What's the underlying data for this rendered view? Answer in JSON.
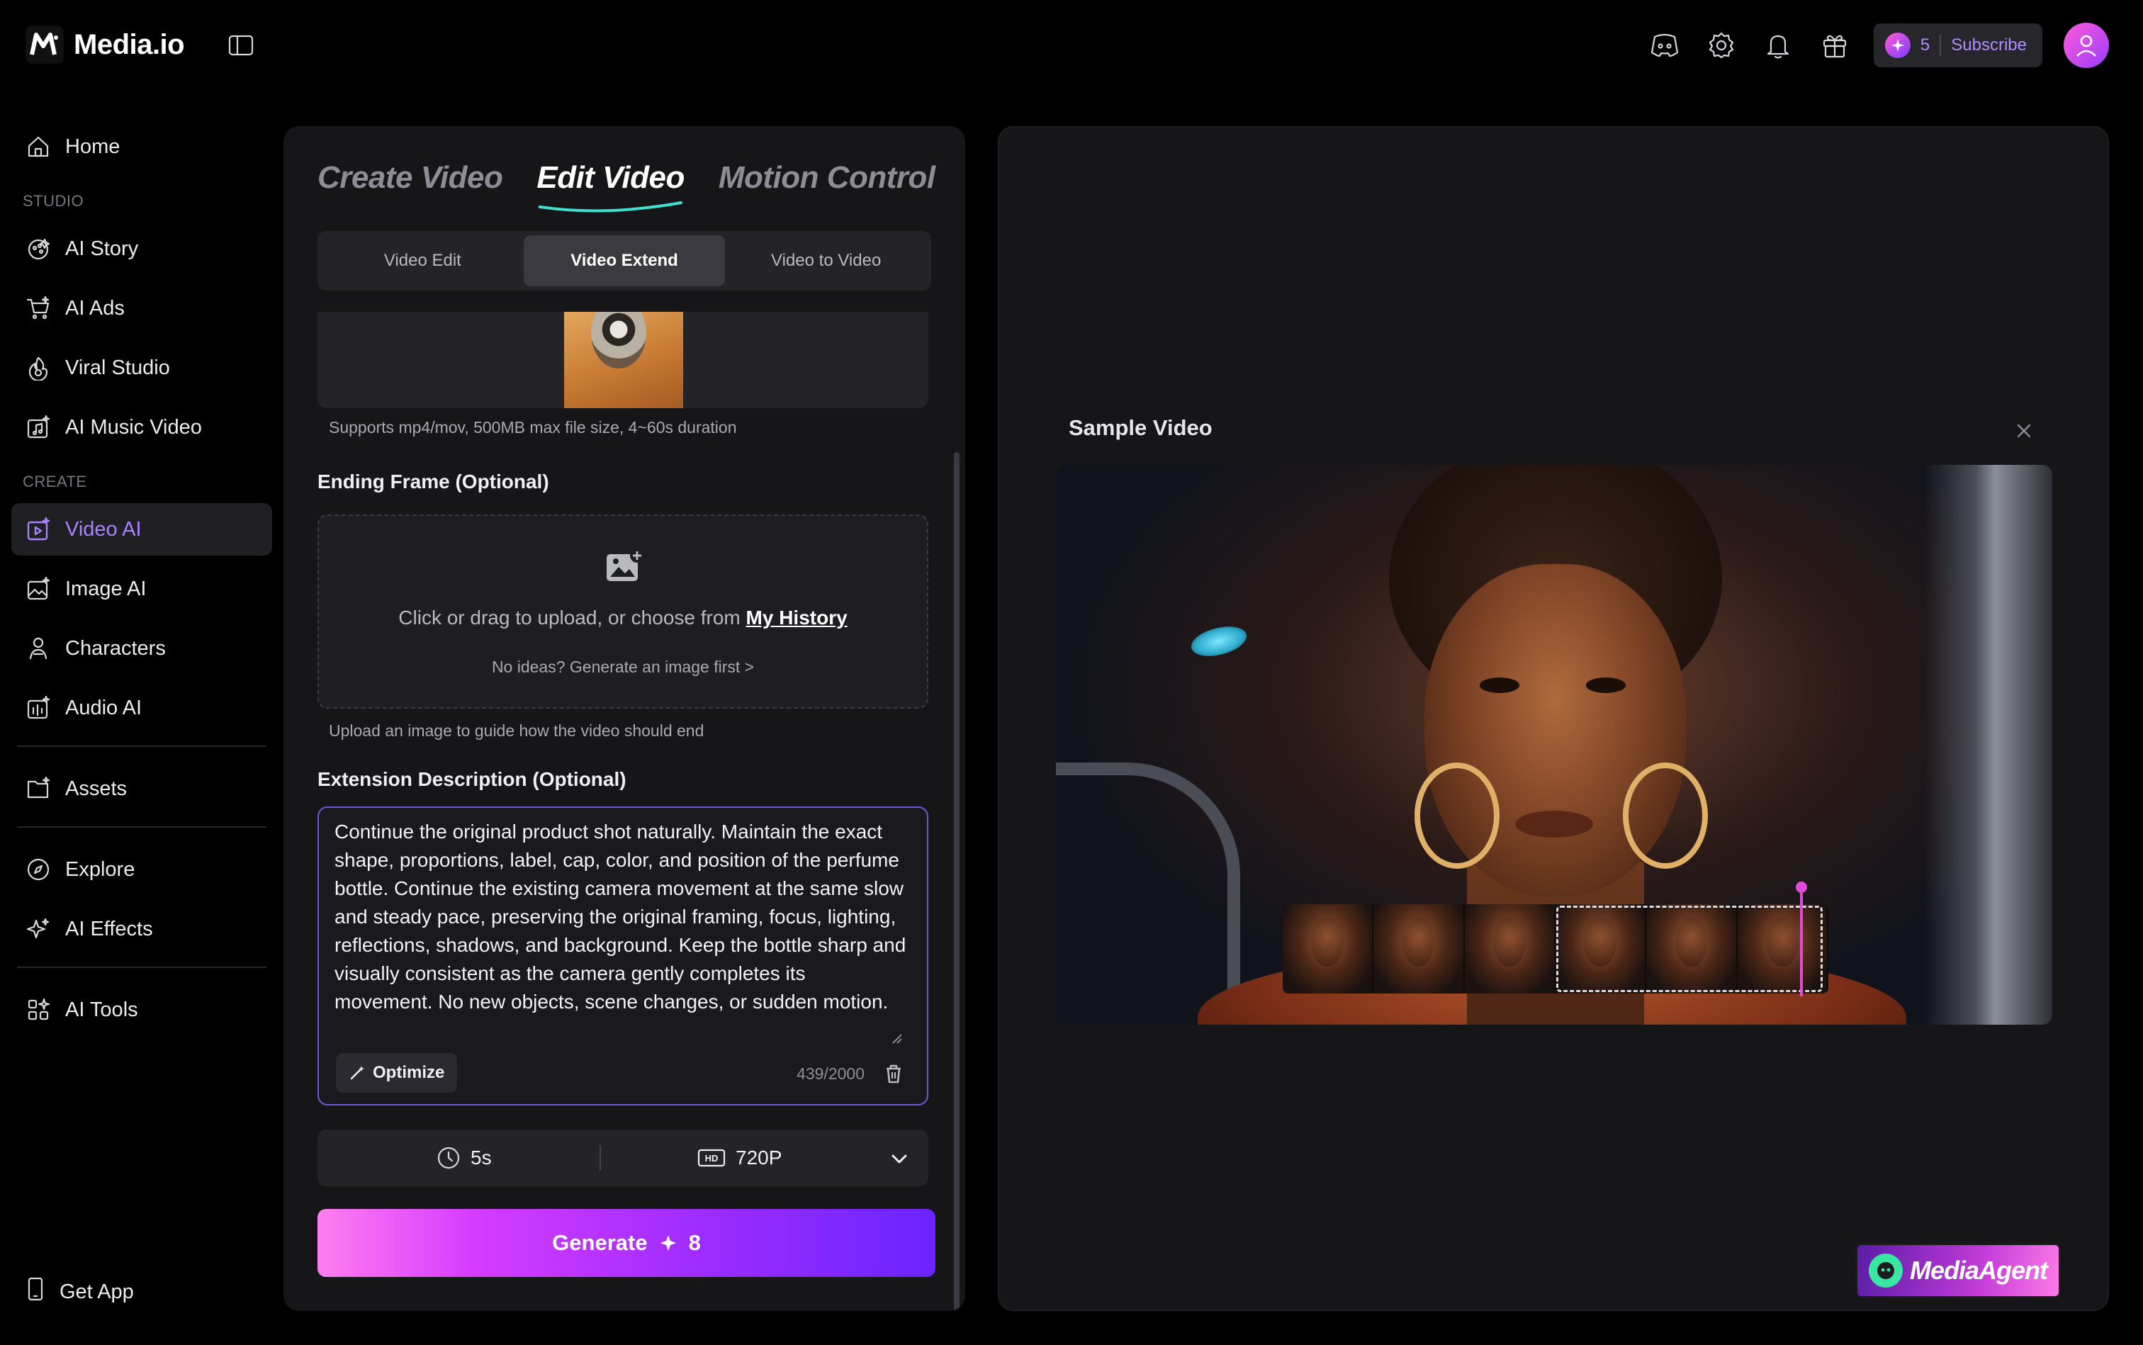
{
  "app": {
    "name": "Media.io"
  },
  "topbar": {
    "credits": "5",
    "subscribe_label": "Subscribe"
  },
  "sidebar": {
    "home": "Home",
    "section_studio": "STUDIO",
    "studio_items": [
      "AI Story",
      "AI Ads",
      "Viral Studio",
      "AI Music Video"
    ],
    "section_create": "CREATE",
    "create_items": [
      "Video AI",
      "Image AI",
      "Characters",
      "Audio AI"
    ],
    "assets": "Assets",
    "explore": "Explore",
    "effects": "AI Effects",
    "tools": "AI Tools",
    "get_app": "Get App"
  },
  "panel": {
    "mode_tabs": [
      "Create Video",
      "Edit Video",
      "Motion Control"
    ],
    "active_mode": "Edit Video",
    "sub_tabs": [
      "Video Edit",
      "Video Extend",
      "Video to Video"
    ],
    "active_sub_tab": "Video Extend",
    "upload_hint": "Supports mp4/mov, 500MB max file size, 4~60s duration",
    "ending_frame_label": "Ending Frame (Optional)",
    "dropzone_text": "Click or drag to upload, or choose from",
    "dropzone_link": "My History",
    "dropzone_sub": "No ideas? Generate an image first >",
    "ending_frame_hint": "Upload an image to guide how the video should end",
    "extension_label": "Extension Description (Optional)",
    "extension_text": "Continue the original product shot naturally. Maintain the exact shape, proportions, label, cap, color, and position of the perfume bottle. Continue the existing camera movement at the same slow and steady pace, preserving the original framing, focus, lighting, reflections, shadows, and background. Keep the bottle sharp and visually consistent as the camera gently completes its movement. No new objects, scene changes, or sudden motion.",
    "optimize_label": "Optimize",
    "char_count": "439/2000",
    "duration": "5s",
    "quality_badge": "HD",
    "quality": "720P",
    "generate_label": "Generate",
    "generate_cost": "8"
  },
  "preview": {
    "title": "Sample Video",
    "agent_label": "MediaAgent"
  },
  "colors": {
    "accent": "#a983ff",
    "generate_start": "#ff7ef0",
    "generate_end": "#6a24ff"
  }
}
